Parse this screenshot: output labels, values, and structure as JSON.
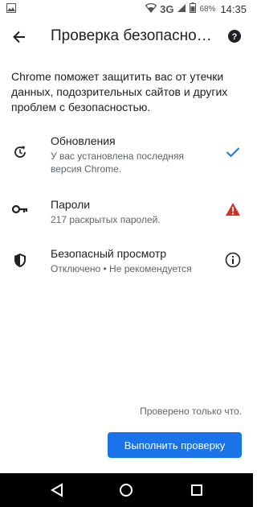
{
  "status_bar": {
    "network": "3G",
    "battery": "68%",
    "time": "14:35"
  },
  "app_bar": {
    "title": "Проверка безопасности",
    "back_icon": "arrow-back-icon",
    "help_icon": "help-icon"
  },
  "intro": "Chrome поможет защитить вас от утечки данных, подозрительных сайтов и других проблем с безопасностью.",
  "items": [
    {
      "title": "Обновления",
      "subtitle": "У вас установлена последняя версия Chrome.",
      "icon": "update-icon",
      "status_icon": "checkmark-icon",
      "status_color": "#1a73e8"
    },
    {
      "title": "Пароли",
      "subtitle": "217 раскрытых паролей.",
      "icon": "key-icon",
      "status_icon": "warning-icon",
      "status_color": "#d93025"
    },
    {
      "title": "Безопасный просмотр",
      "subtitle": "Отключено • Не рекомендуется",
      "icon": "shield-icon",
      "status_icon": "info-icon",
      "status_color": "#202124"
    }
  ],
  "footer": {
    "checked_text": "Проверено только что.",
    "run_button": "Выполнить проверку"
  },
  "colors": {
    "accent": "#1a73e8"
  }
}
